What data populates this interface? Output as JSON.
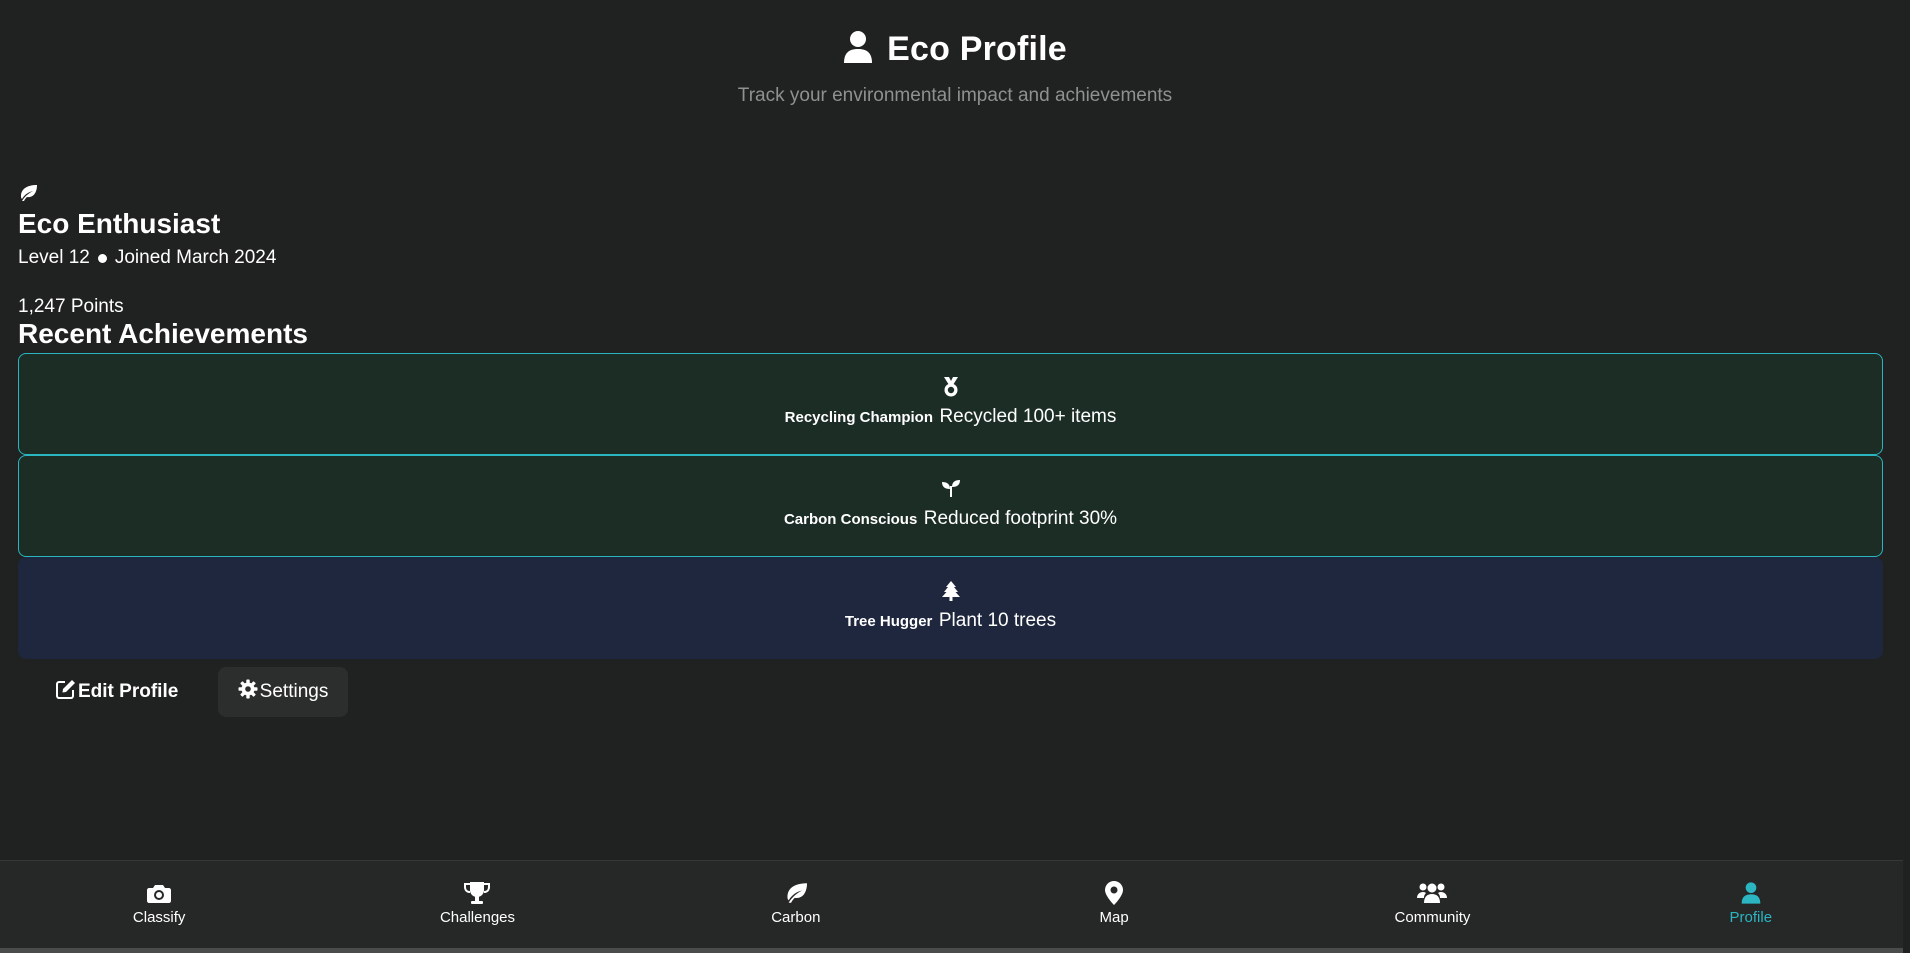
{
  "header": {
    "title": "Eco Profile",
    "subtitle": "Track your environmental impact and achievements",
    "icon": "user-icon"
  },
  "profile": {
    "icon": "leaf-icon",
    "name": "Eco Enthusiast",
    "level": "Level 12",
    "joined": "Joined March 2024",
    "points": "1,247 Points"
  },
  "achievements": {
    "title": "Recent Achievements",
    "items": [
      {
        "icon": "medal-icon",
        "name": "Recycling Champion",
        "description": "Recycled 100+ items",
        "status": "unlocked"
      },
      {
        "icon": "seedling-icon",
        "name": "Carbon Conscious",
        "description": "Reduced footprint 30%",
        "status": "unlocked"
      },
      {
        "icon": "tree-icon",
        "name": "Tree Hugger",
        "description": "Plant 10 trees",
        "status": "locked"
      }
    ]
  },
  "actions": {
    "edit_label": "Edit Profile",
    "settings_label": "Settings"
  },
  "nav": {
    "items": [
      {
        "label": "Classify",
        "icon": "camera-icon"
      },
      {
        "label": "Challenges",
        "icon": "trophy-icon"
      },
      {
        "label": "Carbon",
        "icon": "leaf-icon"
      },
      {
        "label": "Map",
        "icon": "map-pin-icon"
      },
      {
        "label": "Community",
        "icon": "users-icon"
      },
      {
        "label": "Profile",
        "icon": "user-icon",
        "active": true
      }
    ]
  },
  "colors": {
    "background": "#202121",
    "accent": "#2ab5c1",
    "unlocked_card": "#1c2d25",
    "locked_card": "#1e273d",
    "nav_background": "#262727"
  }
}
